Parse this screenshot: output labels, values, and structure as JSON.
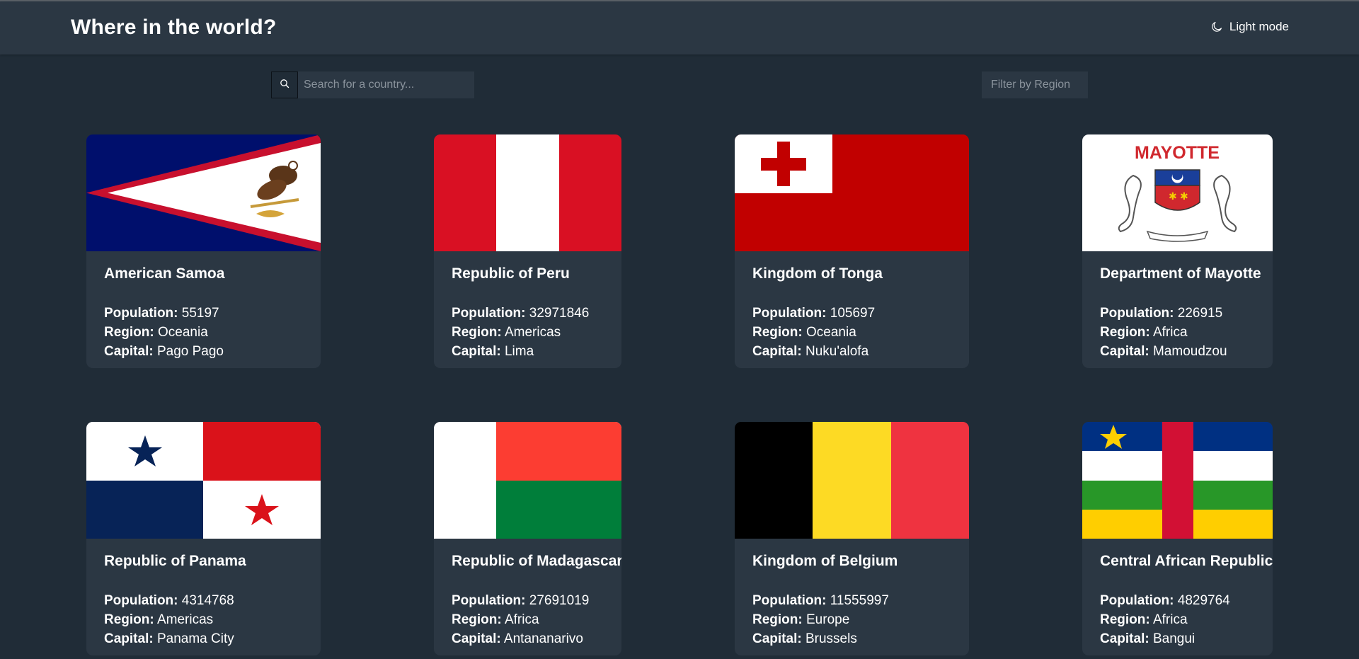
{
  "header": {
    "title": "Where in the world?",
    "theme_toggle_label": "Light mode",
    "theme_icon": "moon-icon"
  },
  "controls": {
    "search_icon": "search-icon",
    "search_placeholder": "Search for a country...",
    "search_value": "",
    "filter_label": "Filter by Region"
  },
  "labels": {
    "population": "Population:",
    "region": "Region:",
    "capital": "Capital:"
  },
  "countries": [
    {
      "name": "American Samoa",
      "population": "55197",
      "region": "Oceania",
      "capital": "Pago Pago",
      "flag": "american-samoa-flag"
    },
    {
      "name": "Republic of Peru",
      "population": "32971846",
      "region": "Americas",
      "capital": "Lima",
      "flag": "peru-flag"
    },
    {
      "name": "Kingdom of Tonga",
      "population": "105697",
      "region": "Oceania",
      "capital": "Nuku'alofa",
      "flag": "tonga-flag"
    },
    {
      "name": "Department of Mayotte",
      "population": "226915",
      "region": "Africa",
      "capital": "Mamoudzou",
      "flag": "mayotte-flag",
      "flag_text": "MAYOTTE"
    },
    {
      "name": "Republic of Panama",
      "population": "4314768",
      "region": "Americas",
      "capital": "Panama City",
      "flag": "panama-flag"
    },
    {
      "name": "Republic of Madagascar",
      "population": "27691019",
      "region": "Africa",
      "capital": "Antananarivo",
      "flag": "madagascar-flag"
    },
    {
      "name": "Kingdom of Belgium",
      "population": "11555997",
      "region": "Europe",
      "capital": "Brussels",
      "flag": "belgium-flag"
    },
    {
      "name": "Central African Republic",
      "population": "4829764",
      "region": "Africa",
      "capital": "Bangui",
      "flag": "central-african-republic-flag"
    }
  ],
  "colors": {
    "background": "#202c37",
    "elements": "#2b3743",
    "text": "#ffffff"
  }
}
